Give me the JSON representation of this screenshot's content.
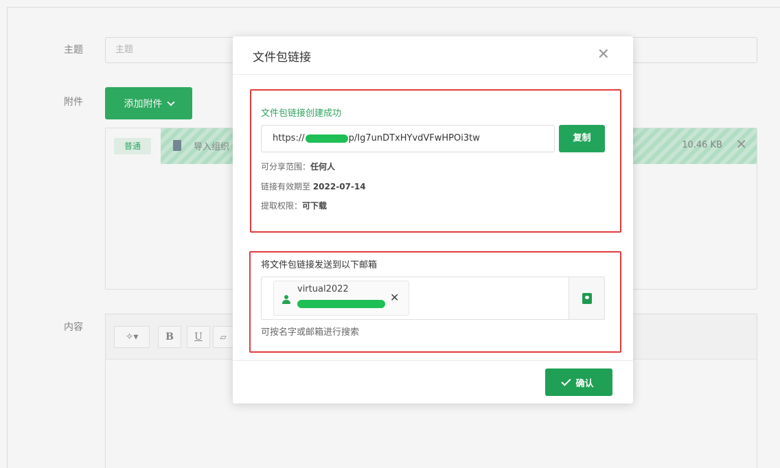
{
  "form": {
    "subject_label": "主题",
    "subject_placeholder": "主题",
    "attachment_label": "附件",
    "add_attachment_button": "添加附件",
    "attachment": {
      "type_badge": "普通",
      "name": "导入组织",
      "size": "10.46 KB"
    },
    "content_label": "内容",
    "toolbar": {
      "bold": "B",
      "underline": "U"
    }
  },
  "modal": {
    "title": "文件包链接",
    "success_text": "文件包链接创建成功",
    "link_prefix": "https://",
    "link_suffix": "p/Ig7unDTxHYvdVFwHPOi3tw",
    "copy_button": "复制",
    "share_scope_label": "可分享范围：",
    "share_scope_value": "任何人",
    "valid_until_label": "链接有效期至 ",
    "valid_until_value": "2022-07-14",
    "permission_label": "提取权限：",
    "permission_value": "可下载",
    "send_title": "将文件包链接发送到以下邮箱",
    "recipient": {
      "name": "virtual2022"
    },
    "search_hint": "可按名字或邮箱进行搜索",
    "confirm_button": "确认"
  },
  "colors": {
    "brand_green": "#2fb064",
    "highlight_red": "#e23b3b"
  },
  "icons": {
    "close": "close-icon",
    "chevron": "chevron-down-icon",
    "check": "check-icon",
    "person": "person-icon",
    "contacts": "contacts-icon",
    "file": "file-icon",
    "magic": "magic-wand-icon",
    "eraser": "eraser-icon"
  }
}
